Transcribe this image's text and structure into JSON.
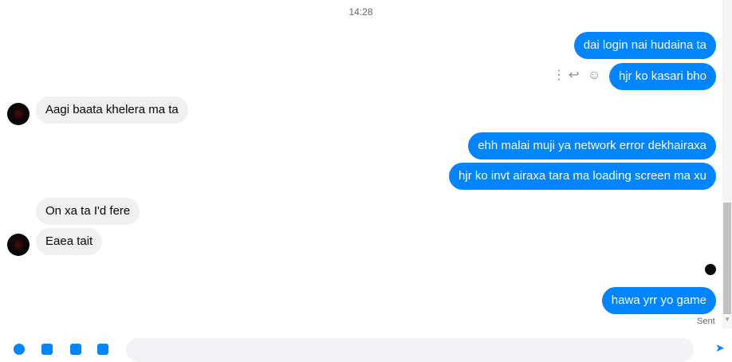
{
  "timestamp": "14:28",
  "messages": [
    {
      "text": "dai login nai hudaina ta",
      "dir": "out"
    },
    {
      "text": "hjr ko kasari bho",
      "dir": "out"
    },
    {
      "text": "Aagi baata khelera ma ta",
      "dir": "in"
    },
    {
      "text": "ehh malai muji ya network error dekhairaxa",
      "dir": "out"
    },
    {
      "text": "hjr ko invt airaxa tara ma loading screen ma xu",
      "dir": "out"
    },
    {
      "text": "On xa ta I'd fere",
      "dir": "in"
    },
    {
      "text": "Eaea tait",
      "dir": "in"
    },
    {
      "text": "hawa yrr yo game",
      "dir": "out"
    }
  ],
  "actions": {
    "more": "⋮",
    "reply": "↩",
    "react": "☺"
  },
  "status": "Sent",
  "colors": {
    "outgoing": "#0084ff",
    "incoming": "#f0f0f0",
    "meta": "#65676b"
  },
  "icons": [
    "more-options-icon",
    "reply-icon",
    "react-icon",
    "send-icon"
  ]
}
